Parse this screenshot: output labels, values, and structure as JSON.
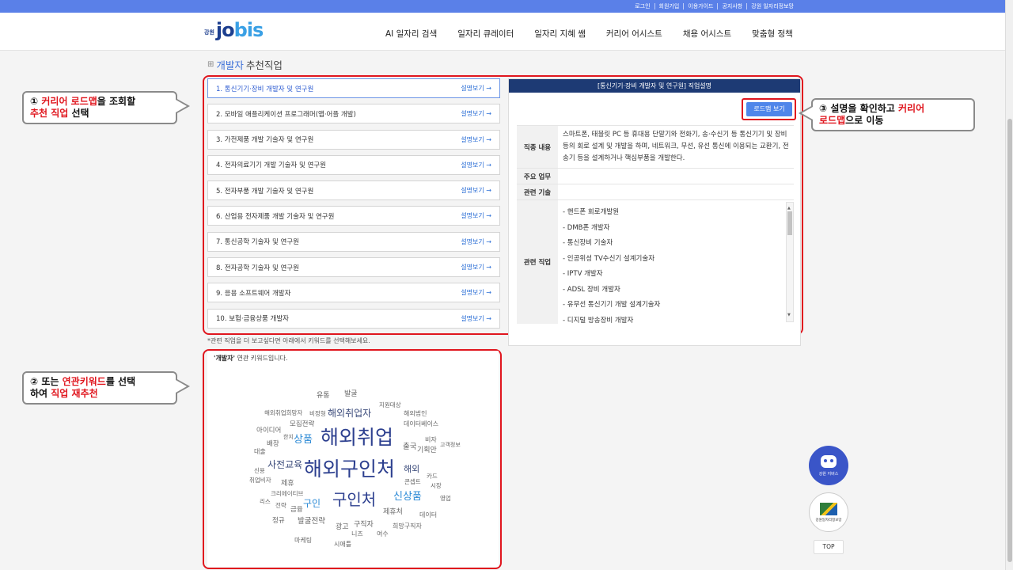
{
  "topbar": {
    "links": [
      "로그인",
      "회원가입",
      "이용가이드",
      "공지사항",
      "강원 일자리정보망"
    ]
  },
  "logo": {
    "small": "강원",
    "main": "jo",
    "accent": "bis"
  },
  "nav": {
    "items": [
      "AI 일자리 검색",
      "일자리 큐레이터",
      "일자리 지혜 쌤",
      "커리어 어시스트",
      "채용 어시스트",
      "맞춤형 정책"
    ]
  },
  "page": {
    "title_accent": "개발자",
    "title_rest": " 추천직업"
  },
  "jobs": {
    "more_label": "설명보기 →",
    "items": [
      "1. 통신기기·장비 개발자 및 연구원",
      "2. 모바일 애플리케이션 프로그래머(앱·어플 개발)",
      "3. 가전제품 개발 기술자 및 연구원",
      "4. 전자의료기기 개발 기술자 및 연구원",
      "5. 전자부품 개발 기술자 및 연구원",
      "6. 산업용 전자제품 개발 기술자 및 연구원",
      "7. 통신공학 기술자 및 연구원",
      "8. 전자공학 기술자 및 연구원",
      "9. 응용 소프트웨어 개발자",
      "10. 보험·금융상품 개발자"
    ],
    "note": "*관련 직업을 더 보고싶다면 아래에서 키워드를 선택해보세요."
  },
  "detail": {
    "header": "[통신기기·장비 개발자 및 연구원] 직업설명",
    "roadmap_button": "로드맵 보기",
    "labels": {
      "duty": "직종 내용",
      "main_work": "주요 업무",
      "tech": "관련 기술",
      "related": "관련 직업"
    },
    "duty_text": "스마트폰, 태블릿 PC 등 휴대용 단말기와 전화기, 송·수신기 등 통신기기 및 장비 등의 회로 설계 및 개발을 하며, 네트워크, 무선, 유선 통신에 이용되는 교환기, 전송기 등을 설계하거나 핵심부품을 개발한다.",
    "related_jobs": [
      "- 핸드폰 회로개발원",
      "- DMB폰 개발자",
      "- 통신장비 기술자",
      "- 인공위성 TV수신기 설계기술자",
      "- IPTV 개발자",
      "- ADSL 장비 개발자",
      "- 유무선 통신기기 개발 설계기술자",
      "- 디지털 방송장비 개발자"
    ]
  },
  "cloud": {
    "caption_bold": "'개발자'",
    "caption_rest": " 연관 키워드입니다.",
    "words": [
      "해외구인처",
      "해외취업",
      "구인처",
      "해외취업자",
      "사전교육",
      "상품",
      "신상품",
      "구인",
      "해외",
      "발굴전략",
      "출국",
      "기획안",
      "제휴처",
      "희망구직자",
      "구직자",
      "광고",
      "해외법인",
      "데이터베이스",
      "해외취업희망자",
      "비정형",
      "지원대상",
      "모집전략",
      "아이디어",
      "제휴",
      "크리에이티브",
      "금융",
      "정규",
      "마케팅",
      "시애틀",
      "니즈",
      "여수",
      "전략",
      "리스",
      "취업비자",
      "신용",
      "배장",
      "대출",
      "발굴",
      "유통",
      "데이터",
      "영업",
      "콘셉트",
      "시장",
      "카드",
      "비자",
      "고객정보",
      "한지"
    ]
  },
  "callouts": {
    "c1": {
      "num": "①",
      "hl1": "커리어 로드맵",
      "t1": "을 조회할",
      "hl2": "추천 직업",
      "t2": " 선택"
    },
    "c2": {
      "num": "②",
      "t1": " 또는 ",
      "hl1": "연관키워드",
      "t2": "를 선택",
      "t3": "하여 ",
      "hl2": "직업 재추천"
    },
    "c3": {
      "num": "③",
      "t1": " 설명을 확인하고 ",
      "hl1": "커리어",
      "hl2": "로드맵",
      "t2": "으로 이동"
    }
  },
  "side": {
    "robot_label": "강원 지버스",
    "emblem_label": "강원일자리정보망",
    "top_label": "TOP"
  },
  "colors": {
    "accent": "#5a80e8",
    "navy": "#1d3a74",
    "highlight": "#e0161e",
    "keyword_dark": "#2c3f8f",
    "keyword_light": "#2c8ad6"
  }
}
